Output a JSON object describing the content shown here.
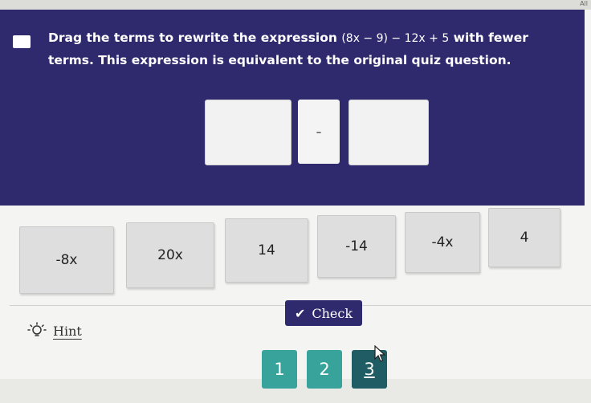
{
  "window": {
    "corner_label": "All"
  },
  "question": {
    "prompt_prefix": "Drag the terms to rewrite the expression ",
    "expression": "(8x − 9) − 12x + 5",
    "prompt_middle": " with fewer ",
    "keyword": "terms",
    "prompt_suffix": ". This expression is equivalent to the original quiz question.",
    "operator": "-"
  },
  "tiles": [
    "-8x",
    "20x",
    "14",
    "-14",
    "-4x",
    "4"
  ],
  "check": {
    "label": "Check"
  },
  "hint": {
    "label": "Hint"
  },
  "pagination": [
    "1",
    "2",
    "3"
  ],
  "colors": {
    "primary": "#2f2a6e",
    "page_active": "#1f5c63",
    "page": "#37a39a"
  }
}
